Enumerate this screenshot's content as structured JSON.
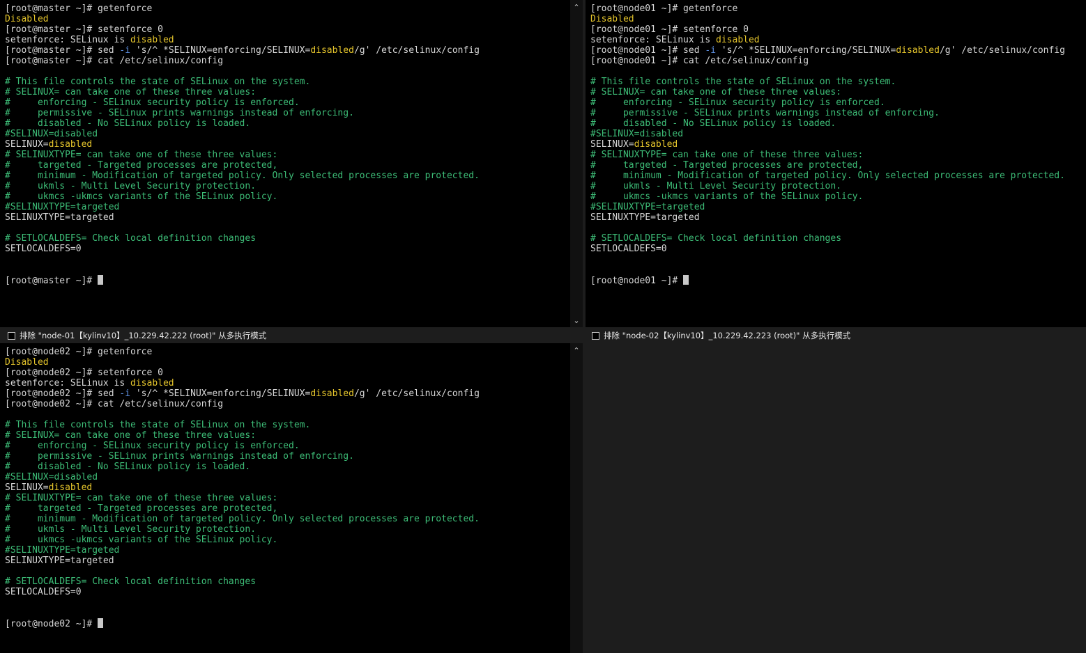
{
  "colors": {
    "background": "#000000",
    "default_text": "#d7d7d7",
    "yellow_text": "#e6c62c",
    "green_comment": "#3dbd77",
    "blue_flag": "#5d8fe0",
    "chrome": "#1d1d1d"
  },
  "icons": {
    "scroll_up": "▲",
    "scroll_down": "⌄",
    "scroll_up_small": "⌃"
  },
  "panes": [
    {
      "host": "master",
      "lines": [
        [
          {
            "t": "[root@master ~]# getenforce",
            "c": "default"
          }
        ],
        [
          {
            "t": "Disabled",
            "c": "yellow"
          }
        ],
        [
          {
            "t": "[root@master ~]# setenforce 0",
            "c": "default"
          }
        ],
        [
          {
            "t": "setenforce: SELinux is ",
            "c": "default"
          },
          {
            "t": "disabled",
            "c": "yellow"
          }
        ],
        [
          {
            "t": "[root@master ~]# sed ",
            "c": "default"
          },
          {
            "t": "-i",
            "c": "blue"
          },
          {
            "t": " 's/^ *SELINUX=enforcing/SELINUX=",
            "c": "default"
          },
          {
            "t": "disabled",
            "c": "yellow"
          },
          {
            "t": "/g' /etc/selinux/config",
            "c": "default"
          }
        ],
        [
          {
            "t": "[root@master ~]# cat /etc/selinux/config",
            "c": "default"
          }
        ],
        [],
        [
          {
            "t": "# This file controls the state of SELinux on the system.",
            "c": "green"
          }
        ],
        [
          {
            "t": "# SELINUX= can take one of these three values:",
            "c": "green"
          }
        ],
        [
          {
            "t": "#     enforcing - SELinux security policy is enforced.",
            "c": "green"
          }
        ],
        [
          {
            "t": "#     permissive - SELinux prints warnings instead of enforcing.",
            "c": "green"
          }
        ],
        [
          {
            "t": "#     disabled - No SELinux policy is loaded.",
            "c": "green"
          }
        ],
        [
          {
            "t": "#SELINUX=disabled",
            "c": "green"
          }
        ],
        [
          {
            "t": "SELINUX=",
            "c": "default"
          },
          {
            "t": "disabled",
            "c": "yellow"
          }
        ],
        [
          {
            "t": "# SELINUXTYPE= can take one of these three values:",
            "c": "green"
          }
        ],
        [
          {
            "t": "#     targeted - Targeted processes are protected,",
            "c": "green"
          }
        ],
        [
          {
            "t": "#     minimum - Modification of targeted policy. Only selected processes are protected.",
            "c": "green"
          }
        ],
        [
          {
            "t": "#     ukmls - Multi Level Security protection.",
            "c": "green"
          }
        ],
        [
          {
            "t": "#     ukmcs -ukmcs variants of the SELinux policy.",
            "c": "green"
          }
        ],
        [
          {
            "t": "#SELINUXTYPE=targeted",
            "c": "green"
          }
        ],
        [
          {
            "t": "SELINUXTYPE=targeted",
            "c": "default"
          }
        ],
        [],
        [
          {
            "t": "# SETLOCALDEFS= Check local definition changes",
            "c": "green"
          }
        ],
        [
          {
            "t": "SETLOCALDEFS=0",
            "c": "default"
          }
        ],
        [],
        [],
        [
          {
            "t": "[root@master ~]# ",
            "c": "default"
          }
        ]
      ],
      "exclude_label": "排除 \"node-01【kylinv10】_10.229.42.222 (root)\" 从多执行模式"
    },
    {
      "host": "node01",
      "lines": [
        [
          {
            "t": "[root@node01 ~]# getenforce",
            "c": "default"
          }
        ],
        [
          {
            "t": "Disabled",
            "c": "yellow"
          }
        ],
        [
          {
            "t": "[root@node01 ~]# setenforce 0",
            "c": "default"
          }
        ],
        [
          {
            "t": "setenforce: SELinux is ",
            "c": "default"
          },
          {
            "t": "disabled",
            "c": "yellow"
          }
        ],
        [
          {
            "t": "[root@node01 ~]# sed ",
            "c": "default"
          },
          {
            "t": "-i",
            "c": "blue"
          },
          {
            "t": " 's/^ *SELINUX=enforcing/SELINUX=",
            "c": "default"
          },
          {
            "t": "disabled",
            "c": "yellow"
          },
          {
            "t": "/g' /etc/selinux/config",
            "c": "default"
          }
        ],
        [
          {
            "t": "[root@node01 ~]# cat /etc/selinux/config",
            "c": "default"
          }
        ],
        [],
        [
          {
            "t": "# This file controls the state of SELinux on the system.",
            "c": "green"
          }
        ],
        [
          {
            "t": "# SELINUX= can take one of these three values:",
            "c": "green"
          }
        ],
        [
          {
            "t": "#     enforcing - SELinux security policy is enforced.",
            "c": "green"
          }
        ],
        [
          {
            "t": "#     permissive - SELinux prints warnings instead of enforcing.",
            "c": "green"
          }
        ],
        [
          {
            "t": "#     disabled - No SELinux policy is loaded.",
            "c": "green"
          }
        ],
        [
          {
            "t": "#SELINUX=disabled",
            "c": "green"
          }
        ],
        [
          {
            "t": "SELINUX=",
            "c": "default"
          },
          {
            "t": "disabled",
            "c": "yellow"
          }
        ],
        [
          {
            "t": "# SELINUXTYPE= can take one of these three values:",
            "c": "green"
          }
        ],
        [
          {
            "t": "#     targeted - Targeted processes are protected,",
            "c": "green"
          }
        ],
        [
          {
            "t": "#     minimum - Modification of targeted policy. Only selected processes are protected.",
            "c": "green"
          }
        ],
        [
          {
            "t": "#     ukmls - Multi Level Security protection.",
            "c": "green"
          }
        ],
        [
          {
            "t": "#     ukmcs -ukmcs variants of the SELinux policy.",
            "c": "green"
          }
        ],
        [
          {
            "t": "#SELINUXTYPE=targeted",
            "c": "green"
          }
        ],
        [
          {
            "t": "SELINUXTYPE=targeted",
            "c": "default"
          }
        ],
        [],
        [
          {
            "t": "# SETLOCALDEFS= Check local definition changes",
            "c": "green"
          }
        ],
        [
          {
            "t": "SETLOCALDEFS=0",
            "c": "default"
          }
        ],
        [],
        [],
        [
          {
            "t": "[root@node01 ~]# ",
            "c": "default"
          }
        ]
      ],
      "exclude_label": "排除 \"node-02【kylinv10】_10.229.42.223 (root)\" 从多执行模式"
    },
    {
      "host": "node02",
      "lines": [
        [
          {
            "t": "[root@node02 ~]# getenforce",
            "c": "default"
          }
        ],
        [
          {
            "t": "Disabled",
            "c": "yellow"
          }
        ],
        [
          {
            "t": "[root@node02 ~]# setenforce 0",
            "c": "default"
          }
        ],
        [
          {
            "t": "setenforce: SELinux is ",
            "c": "default"
          },
          {
            "t": "disabled",
            "c": "yellow"
          }
        ],
        [
          {
            "t": "[root@node02 ~]# sed ",
            "c": "default"
          },
          {
            "t": "-i",
            "c": "blue"
          },
          {
            "t": " 's/^ *SELINUX=enforcing/SELINUX=",
            "c": "default"
          },
          {
            "t": "disabled",
            "c": "yellow"
          },
          {
            "t": "/g' /etc/selinux/config",
            "c": "default"
          }
        ],
        [
          {
            "t": "[root@node02 ~]# cat /etc/selinux/config",
            "c": "default"
          }
        ],
        [],
        [
          {
            "t": "# This file controls the state of SELinux on the system.",
            "c": "green"
          }
        ],
        [
          {
            "t": "# SELINUX= can take one of these three values:",
            "c": "green"
          }
        ],
        [
          {
            "t": "#     enforcing - SELinux security policy is enforced.",
            "c": "green"
          }
        ],
        [
          {
            "t": "#     permissive - SELinux prints warnings instead of enforcing.",
            "c": "green"
          }
        ],
        [
          {
            "t": "#     disabled - No SELinux policy is loaded.",
            "c": "green"
          }
        ],
        [
          {
            "t": "#SELINUX=disabled",
            "c": "green"
          }
        ],
        [
          {
            "t": "SELINUX=",
            "c": "default"
          },
          {
            "t": "disabled",
            "c": "yellow"
          }
        ],
        [
          {
            "t": "# SELINUXTYPE= can take one of these three values:",
            "c": "green"
          }
        ],
        [
          {
            "t": "#     targeted - Targeted processes are protected,",
            "c": "green"
          }
        ],
        [
          {
            "t": "#     minimum - Modification of targeted policy. Only selected processes are protected.",
            "c": "green"
          }
        ],
        [
          {
            "t": "#     ukmls - Multi Level Security protection.",
            "c": "green"
          }
        ],
        [
          {
            "t": "#     ukmcs -ukmcs variants of the SELinux policy.",
            "c": "green"
          }
        ],
        [
          {
            "t": "#SELINUXTYPE=targeted",
            "c": "green"
          }
        ],
        [
          {
            "t": "SELINUXTYPE=targeted",
            "c": "default"
          }
        ],
        [],
        [
          {
            "t": "# SETLOCALDEFS= Check local definition changes",
            "c": "green"
          }
        ],
        [
          {
            "t": "SETLOCALDEFS=0",
            "c": "default"
          }
        ],
        [],
        [],
        [
          {
            "t": "[root@node02 ~]# ",
            "c": "default"
          }
        ]
      ]
    }
  ]
}
